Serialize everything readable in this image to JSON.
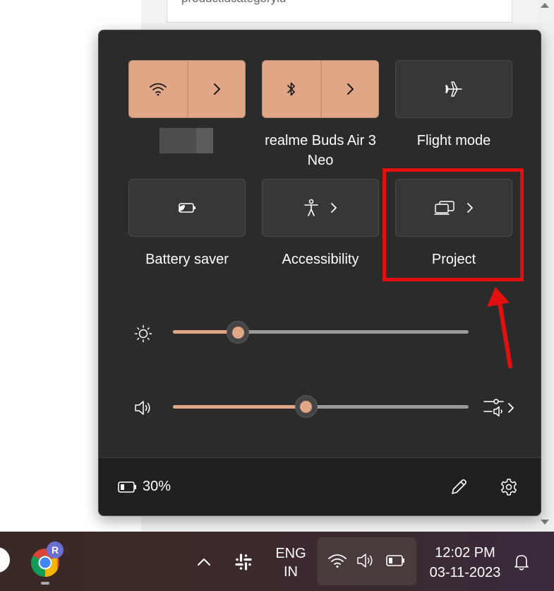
{
  "background": {
    "input_text": "productldcategoryld"
  },
  "quick_settings": {
    "tiles": [
      {
        "id": "wifi",
        "label": "",
        "state": "on",
        "icon": "wifi-icon"
      },
      {
        "id": "bluetooth",
        "label": "realme Buds Air 3 Neo",
        "state": "on",
        "icon": "bluetooth-icon"
      },
      {
        "id": "flight",
        "label": "Flight mode",
        "state": "off",
        "icon": "airplane-icon"
      },
      {
        "id": "battery-saver",
        "label": "Battery saver",
        "state": "off",
        "icon": "battery-saver-icon"
      },
      {
        "id": "accessibility",
        "label": "Accessibility",
        "state": "off",
        "icon": "accessibility-icon"
      },
      {
        "id": "project",
        "label": "Project",
        "state": "off",
        "icon": "project-icon"
      }
    ],
    "brightness": {
      "value": 0.22,
      "icon": "brightness-icon"
    },
    "volume": {
      "value": 0.45,
      "icon": "speaker-icon"
    },
    "footer": {
      "battery_percent": "30%",
      "edit_icon": "pencil-icon",
      "settings_icon": "gear-icon"
    }
  },
  "annotation": {
    "color": "#e41010",
    "target": "Project"
  },
  "taskbar": {
    "language": {
      "line1": "ENG",
      "line2": "IN"
    },
    "time": "12:02 PM",
    "date": "03-11-2023",
    "chrome_badge": "R"
  },
  "colors": {
    "accent": "#e0a686",
    "panel": "#2b2b2b",
    "tile_off": "#373737"
  }
}
